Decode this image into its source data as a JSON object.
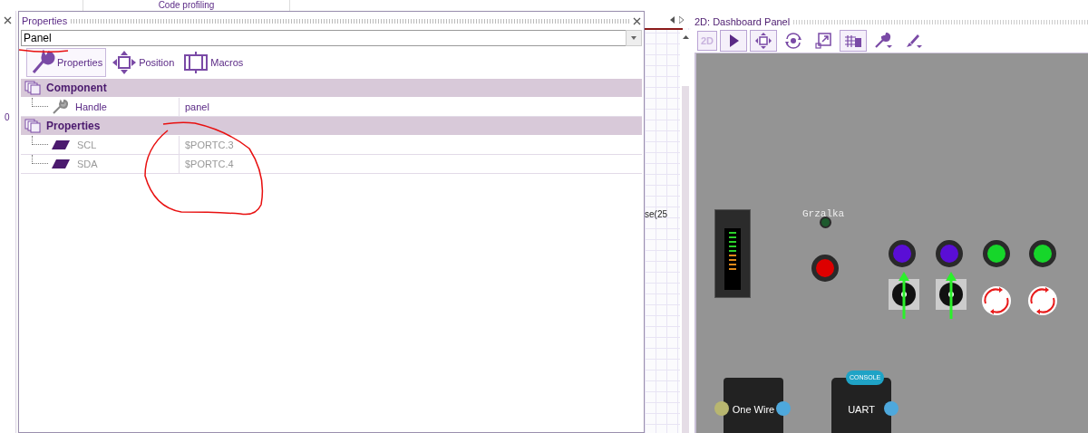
{
  "top_bar": {
    "tab": "Code profiling"
  },
  "left_strip": {
    "text": "0"
  },
  "properties_panel": {
    "title": "Properties",
    "selector": {
      "value": "Panel"
    },
    "tabs": [
      {
        "label": "Properties",
        "kind": "wrench",
        "selected": true
      },
      {
        "label": "Position",
        "kind": "move",
        "selected": false
      },
      {
        "label": "Macros",
        "kind": "macro",
        "selected": false
      }
    ],
    "sections": [
      {
        "title": "Component",
        "rows": [
          {
            "name": "Handle",
            "value": "panel",
            "kind": "handle",
            "disabled": false
          }
        ]
      },
      {
        "title": "Properties",
        "rows": [
          {
            "name": "SCL",
            "value": "$PORTC.3",
            "kind": "port",
            "disabled": true
          },
          {
            "name": "SDA",
            "value": "$PORTC.4",
            "kind": "port",
            "disabled": true
          }
        ]
      }
    ]
  },
  "code_strip": {
    "text": "se(25"
  },
  "dashboard": {
    "title": "2D: Dashboard Panel",
    "toolbar": [
      {
        "kind": "label2d",
        "text": "2D",
        "selected": true
      },
      {
        "kind": "pointer",
        "selected": true
      },
      {
        "kind": "move",
        "selected": true
      },
      {
        "kind": "rotate",
        "selected": false
      },
      {
        "kind": "scale",
        "selected": false
      },
      {
        "kind": "grid",
        "selected": true
      },
      {
        "kind": "wrench",
        "selected": false
      },
      {
        "kind": "brush",
        "selected": false
      }
    ],
    "canvas": {
      "led_label": "Grzalka",
      "knobs": [
        {
          "color": "#dd0000"
        },
        {
          "color": "#5a0ed6"
        },
        {
          "color": "#5a0ed6"
        },
        {
          "color": "#16d62a"
        },
        {
          "color": "#16d62a"
        }
      ],
      "modules": [
        {
          "label": "One Wire",
          "kind": "onewire"
        },
        {
          "label": "UART",
          "kind": "uart",
          "badge": "CONSOLE"
        }
      ]
    }
  }
}
